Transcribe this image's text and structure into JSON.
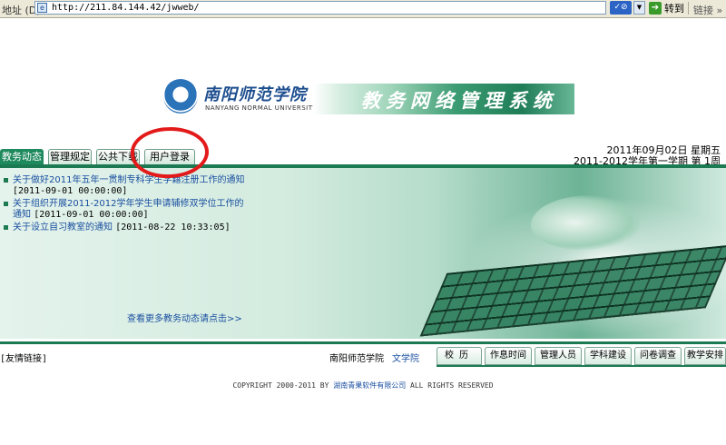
{
  "browser": {
    "address_label": "地址 (D)",
    "url": "http://211.84.144.42/jwweb/",
    "go_label": "转到",
    "links_label": "链接 »"
  },
  "header": {
    "school_name_cn": "南阳师范学院",
    "school_name_en": "NANYANG NORMAL UNIVERSITY",
    "system_title": "教务网络管理系统"
  },
  "tabs": [
    {
      "label": "教务动态",
      "active": true
    },
    {
      "label": "管理规定",
      "active": false
    },
    {
      "label": "公共下载",
      "active": false
    },
    {
      "label": "用户登录",
      "active": false
    }
  ],
  "date_info": {
    "date": "2011年09月02日 星期五",
    "term": "2011-2012学年第一学期 第 1周"
  },
  "news": [
    {
      "title": "关于做好2011年五年一贯制专科学生学籍注册工作的通知",
      "date": "[2011-09-01 00:00:00]"
    },
    {
      "title": "关于组织开展2011-2012学年学生申请辅修双学位工作的通知",
      "date": "[2011-09-01 00:00:00]"
    },
    {
      "title": "关于设立自习教室的通知",
      "date": "[2011-08-22 10:33:05]"
    }
  ],
  "more_link": "查看更多教务动态请点击>>",
  "footer": {
    "friend_links": "[友情链接]",
    "school_link": "南阳师范学院",
    "arts_link": "文学院",
    "tabs": [
      "校历",
      "作息时间",
      "管理人员",
      "学科建设",
      "问卷调查",
      "教学安排"
    ],
    "copyright_pre": "COPYRIGHT 2000-2011 BY ",
    "copyright_company": "湖南青果软件有限公司",
    "copyright_post": " ALL RIGHTS RESERVED"
  },
  "colors": {
    "brand_green": "#1c7a52",
    "link_blue": "#1a4fa0",
    "annotation_red": "#e31a1a"
  }
}
